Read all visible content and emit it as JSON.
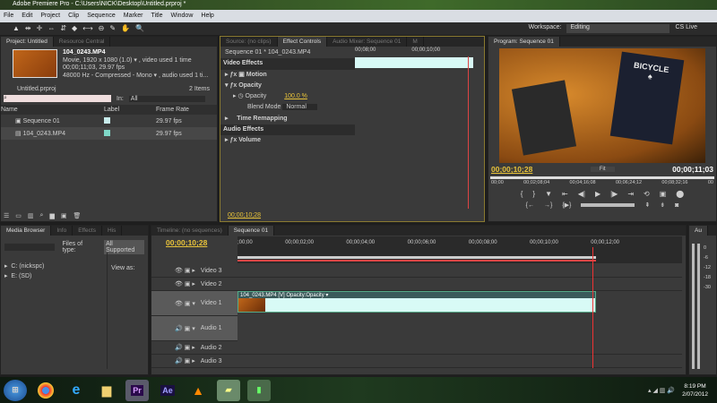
{
  "title": "Adobe Premiere Pro - C:\\Users\\NICK\\Desktop\\Untitled.prproj *",
  "menu": [
    "File",
    "Edit",
    "Project",
    "Clip",
    "Sequence",
    "Marker",
    "Title",
    "Window",
    "Help"
  ],
  "tools": [
    "▲",
    "⇹",
    "✛",
    "⇔",
    "⇵",
    "◆",
    "⟷",
    "⊖",
    "✎",
    "✋",
    "🔍"
  ],
  "workspace": {
    "label": "Workspace:",
    "value": "Editing",
    "cslive": "CS Live"
  },
  "project": {
    "tabs": [
      "Project: Untitled",
      "Resource Central"
    ],
    "clip_name": "104_0243.MP4",
    "clip_info1": "Movie, 1920 x 1080 (1.0) ▾ , video used 1 time",
    "clip_info2": "00;00;11;03, 29.97 fps",
    "clip_info3": "48000 Hz - Compressed - Mono ▾ , audio used 1 ti...",
    "file": "Untitled.prproj",
    "items": "2 Items",
    "in_label": "In:",
    "in_value": "All",
    "columns": [
      "Name",
      "Label",
      "Frame Rate"
    ],
    "rows": [
      {
        "name": "Sequence 01",
        "rate": "29.97 fps",
        "color": "#c8ecec"
      },
      {
        "name": "104_0243.MP4",
        "rate": "29.97 fps",
        "color": "#7fd8c8"
      }
    ]
  },
  "effects": {
    "tabs": [
      "Source: (no clips)",
      "Effect Controls",
      "Audio Mixer: Sequence 01",
      "M"
    ],
    "clip": "Sequence 01 * 104_0243.MP4",
    "video_effects": "Video Effects",
    "motion": "Motion",
    "opacity": "Opacity",
    "opacity_param": "Opacity",
    "opacity_value": "100.0 %",
    "blend_label": "Blend Mode",
    "blend_value": "Normal",
    "time_remap": "Time Remapping",
    "audio_effects": "Audio Effects",
    "volume": "Volume",
    "timecode": "00;00;10;28",
    "ruler": [
      "00;08;00",
      "00;00;10;00"
    ]
  },
  "program": {
    "tab": "Program: Sequence 01",
    "timecode": "00;00;10;28",
    "fit": "Fit",
    "duration": "00;00;11;03",
    "ruler": [
      "00;00",
      "00;02;08;04",
      "00;04;16;08",
      "00;06;24;12",
      "00;08;32;16",
      "00"
    ]
  },
  "media": {
    "tabs": [
      "Media Browser",
      "Info",
      "Effects",
      "His"
    ],
    "files_label": "Files of type:",
    "files_value": "All Supported",
    "drives": [
      "C: (nickspc)",
      "E: (SD)"
    ],
    "view_as": "View as:"
  },
  "timeline": {
    "tabs": [
      "Timeline: (no sequences)",
      "Sequence 01"
    ],
    "timecode": "00;00;10;28",
    "ruler": [
      ";00;00",
      "00;00;02;00",
      "00;00;04;00",
      "00;00;06;00",
      "00;00;08;00",
      "00;00;10;00",
      "00;00;12;00"
    ],
    "tracks": [
      "Video 3",
      "Video 2",
      "Video 1",
      "Audio 1",
      "Audio 2",
      "Audio 3"
    ],
    "clip_label": "104_0243.MP4 [V]  Opacity:Opacity ▾",
    "playhead_fraction": 0.86
  },
  "audio_meter": {
    "tab": "Au",
    "labels": [
      "0",
      "-6",
      "-12",
      "-18",
      "-30"
    ]
  },
  "taskbar": {
    "apps": [
      "Pr",
      "Ae"
    ],
    "time": "8:19 PM",
    "date": "2/07/2012"
  }
}
